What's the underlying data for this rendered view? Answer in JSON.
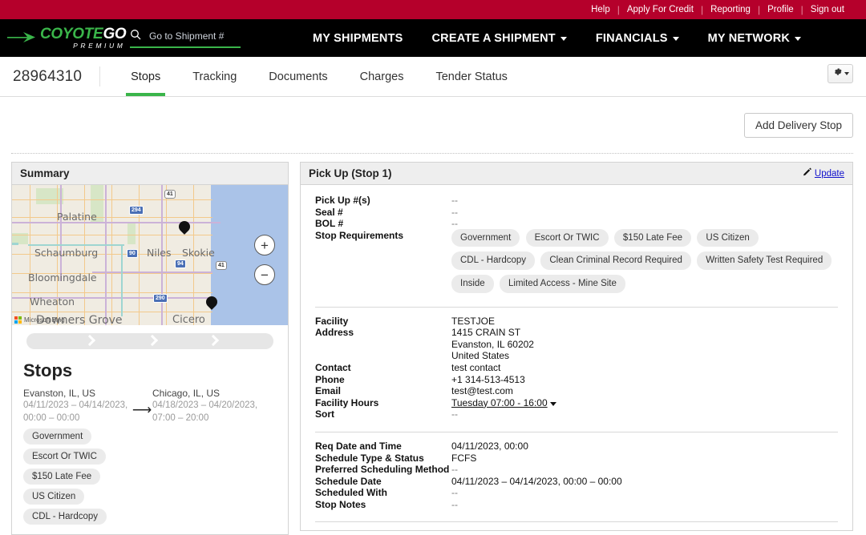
{
  "utility_bar": {
    "links": [
      "Help",
      "Apply For Credit",
      "Reporting",
      "Profile",
      "Sign out"
    ]
  },
  "brand": {
    "name_part1": "COYOTE",
    "name_part2": "GO",
    "tagline": "PREMIUM",
    "arrow_icon": "arrow-right-icon",
    "green": "#3ab54a",
    "red": "#b5002b"
  },
  "search": {
    "placeholder": "Go to Shipment #",
    "value": "",
    "icon": "search-icon"
  },
  "nav": {
    "items": [
      {
        "label": "MY SHIPMENTS",
        "has_caret": false
      },
      {
        "label": "CREATE A SHIPMENT",
        "has_caret": true
      },
      {
        "label": "FINANCIALS",
        "has_caret": true
      },
      {
        "label": "MY NETWORK",
        "has_caret": true
      }
    ]
  },
  "shipment": {
    "id": "28964310",
    "tabs": [
      {
        "label": "Stops",
        "active": true
      },
      {
        "label": "Tracking",
        "active": false
      },
      {
        "label": "Documents",
        "active": false
      },
      {
        "label": "Charges",
        "active": false
      },
      {
        "label": "Tender Status",
        "active": false
      }
    ],
    "settings_icon": "gear-icon"
  },
  "actions": {
    "add_delivery_stop": "Add Delivery Stop"
  },
  "summary": {
    "title": "Summary",
    "map": {
      "attribution": "Microsoft Bing",
      "zoom_in": "+",
      "zoom_out": "−",
      "city_labels": [
        "Palatine",
        "Schaumburg",
        "Niles",
        "Skokie",
        "Bloomingdale",
        "Wheaton",
        "Downers Grove",
        "Cicero"
      ],
      "highway_shields": [
        "294",
        "41",
        "90",
        "94",
        "41",
        "290"
      ]
    },
    "stops_heading": "Stops",
    "origin": {
      "location": "Evanston, IL, US",
      "dates": "04/11/2023 – 04/14/2023,",
      "times": "00:00 – 00:00"
    },
    "destination": {
      "location": "Chicago, IL, US",
      "dates": "04/18/2023 – 04/20/2023,",
      "times": "07:00 – 20:00"
    },
    "requirement_chips": [
      "Government",
      "Escort Or TWIC",
      "$150 Late Fee",
      "US Citizen",
      "CDL - Hardcopy"
    ]
  },
  "stop_detail": {
    "title": "Pick Up (Stop 1)",
    "update_label": "Update",
    "update_icon": "pencil-icon",
    "identifiers": [
      {
        "label": "Pick Up #(s)",
        "value": "--",
        "dash": true
      },
      {
        "label": "Seal #",
        "value": "--",
        "dash": true
      },
      {
        "label": "BOL #",
        "value": "--",
        "dash": true
      }
    ],
    "requirements_label": "Stop Requirements",
    "requirement_chips": [
      "Government",
      "Escort Or TWIC",
      "$150 Late Fee",
      "US Citizen",
      "CDL - Hardcopy",
      "Clean Criminal Record Required",
      "Written Safety Test Required",
      "Inside",
      "Limited Access - Mine Site"
    ],
    "facility": {
      "facility_label": "Facility",
      "facility_value": "TESTJOE",
      "address_label": "Address",
      "address_lines": [
        "1415 CRAIN ST",
        "Evanston, IL 60202",
        "United States"
      ],
      "contact_label": "Contact",
      "contact_value": "test contact",
      "phone_label": "Phone",
      "phone_value": "+1 314-513-4513",
      "email_label": "Email",
      "email_value": "test@test.com",
      "hours_label": "Facility Hours",
      "hours_value": "Tuesday 07:00 - 16:00",
      "sort_label": "Sort",
      "sort_value": "--"
    },
    "schedule": [
      {
        "label": "Req Date and Time",
        "value": "04/11/2023, 00:00",
        "dash": false
      },
      {
        "label": "Schedule Type & Status",
        "value": "FCFS",
        "dash": false
      },
      {
        "label": "Preferred Scheduling Method",
        "value": "--",
        "dash": true
      },
      {
        "label": "Schedule Date",
        "value": "04/11/2023 – 04/14/2023, 00:00 – 00:00",
        "dash": false
      },
      {
        "label": "Scheduled With",
        "value": "--",
        "dash": true
      },
      {
        "label": "Stop Notes",
        "value": "--",
        "dash": true
      }
    ]
  }
}
